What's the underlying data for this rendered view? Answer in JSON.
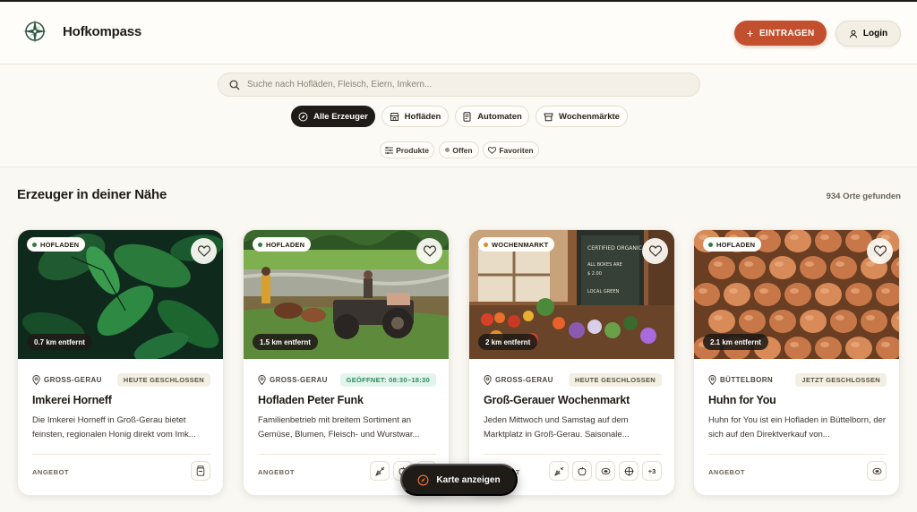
{
  "header": {
    "brand": "Hofkompass",
    "eintragen_label": "EINTRAGEN",
    "login_label": "Login"
  },
  "search": {
    "placeholder": "Suche nach Hofläden, Fleisch, Eiern, Imkern..."
  },
  "categories": [
    {
      "label": "Alle Erzeuger",
      "icon": "compass-icon",
      "active": true
    },
    {
      "label": "Hofläden",
      "icon": "store-icon",
      "active": false
    },
    {
      "label": "Automaten",
      "icon": "vending-machine-icon",
      "active": false
    },
    {
      "label": "Wochenmärkte",
      "icon": "market-stall-icon",
      "active": false
    }
  ],
  "filters": [
    {
      "label": "Produkte",
      "icon": "sliders-icon"
    },
    {
      "label": "Offen",
      "icon": "dot-icon"
    },
    {
      "label": "Favoriten",
      "icon": "heart-icon"
    }
  ],
  "section": {
    "title": "Erzeuger in deiner Nähe",
    "count": "934 Orte gefunden"
  },
  "cards": [
    {
      "type": "HOFLADEN",
      "type_color": "#2f7a4a",
      "distance": "0.7 km entfernt",
      "location": "GROSS-GERAU",
      "status": "HEUTE GESCHLOSSEN",
      "status_kind": "closed",
      "name": "Imkerei Horneff",
      "description": "Die Imkerei Horneff in Groß-Gerau bietet feinsten, regionalen Honig direkt vom Imk...",
      "offer_label": "ANGEBOT",
      "products": [
        "honey-jar-icon"
      ]
    },
    {
      "type": "HOFLADEN",
      "type_color": "#2f7a4a",
      "distance": "1.5 km entfernt",
      "location": "GROSS-GERAU",
      "status": "GEÖFFNET: 08:30–18:30",
      "status_kind": "open",
      "name": "Hofladen Peter Funk",
      "description": "Familienbetrieb mit breitem Sortiment an Gemüse, Blumen, Fleisch- und Wurstwar...",
      "offer_label": "ANGEBOT",
      "products": [
        "carrot-icon",
        "apple-icon",
        "more-icon"
      ],
      "products_more": "9"
    },
    {
      "type": "WOCHENMARKT",
      "type_color": "#d98a2b",
      "distance": "2 km entfernt",
      "location": "GROSS-GERAU",
      "status": "HEUTE GESCHLOSSEN",
      "status_kind": "closed",
      "name": "Groß-Gerauer Wochenmarkt",
      "description": "Jeden Mittwoch und Samstag auf dem Marktplatz in Groß-Gerau. Saisonale...",
      "offer_label": "ANGEBOT",
      "products": [
        "carrot-icon",
        "apple-icon",
        "egg-icon",
        "cheese-icon"
      ],
      "products_more": "+3"
    },
    {
      "type": "HOFLADEN",
      "type_color": "#2f7a4a",
      "distance": "2.1 km entfernt",
      "location": "BÜTTELBORN",
      "status": "JETZT GESCHLOSSEN",
      "status_kind": "closed",
      "name": "Huhn for You",
      "description": "Huhn for You ist ein Hofladen in Büttelborn, der sich auf den Direktverkauf von...",
      "offer_label": "ANGEBOT",
      "products": [
        "egg-icon"
      ]
    }
  ],
  "map_button": {
    "label": "Karte anzeigen"
  },
  "colors": {
    "accent": "#c2502e",
    "dark": "#1f1b16",
    "background": "#faf8f3",
    "open": "#2f8a5c"
  }
}
